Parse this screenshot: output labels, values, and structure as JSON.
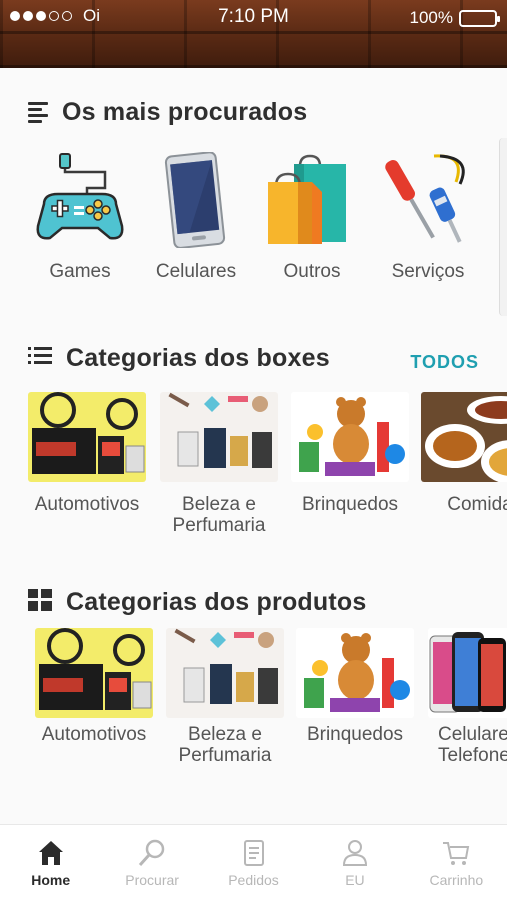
{
  "status_bar": {
    "carrier": "Oi",
    "time": "7:10 PM",
    "battery": "100%"
  },
  "sections": {
    "popular": {
      "title": "Os mais procurados",
      "items": [
        {
          "label": "Games",
          "icon": "gamepad-icon"
        },
        {
          "label": "Celulares",
          "icon": "smartphone-icon"
        },
        {
          "label": "Outros",
          "icon": "shopping-bags-icon"
        },
        {
          "label": "Serviços",
          "icon": "screwdriver-icon"
        }
      ]
    },
    "boxes": {
      "title": "Categorias dos boxes",
      "all_label": "TODOS",
      "items": [
        {
          "label": "Automotivos"
        },
        {
          "label": "Beleza e\nPerfumaria"
        },
        {
          "label": "Brinquedos"
        },
        {
          "label": "Comida"
        }
      ]
    },
    "products": {
      "title": "Categorias dos produtos",
      "items": [
        {
          "label": "Automotivos"
        },
        {
          "label": "Beleza e\nPerfumaria"
        },
        {
          "label": "Brinquedos"
        },
        {
          "label": "Celulares e\nTelefones"
        }
      ]
    }
  },
  "tabbar": {
    "items": [
      {
        "label": "Home",
        "icon": "home-icon",
        "active": true
      },
      {
        "label": "Procurar",
        "icon": "search-icon",
        "active": false
      },
      {
        "label": "Pedidos",
        "icon": "orders-icon",
        "active": false
      },
      {
        "label": "EU",
        "icon": "user-icon",
        "active": false
      },
      {
        "label": "Carrinho",
        "icon": "cart-icon",
        "active": false
      }
    ]
  },
  "colors": {
    "accent": "#1f9fb0",
    "text": "#2f2f2f",
    "muted": "#b7b7b7"
  }
}
